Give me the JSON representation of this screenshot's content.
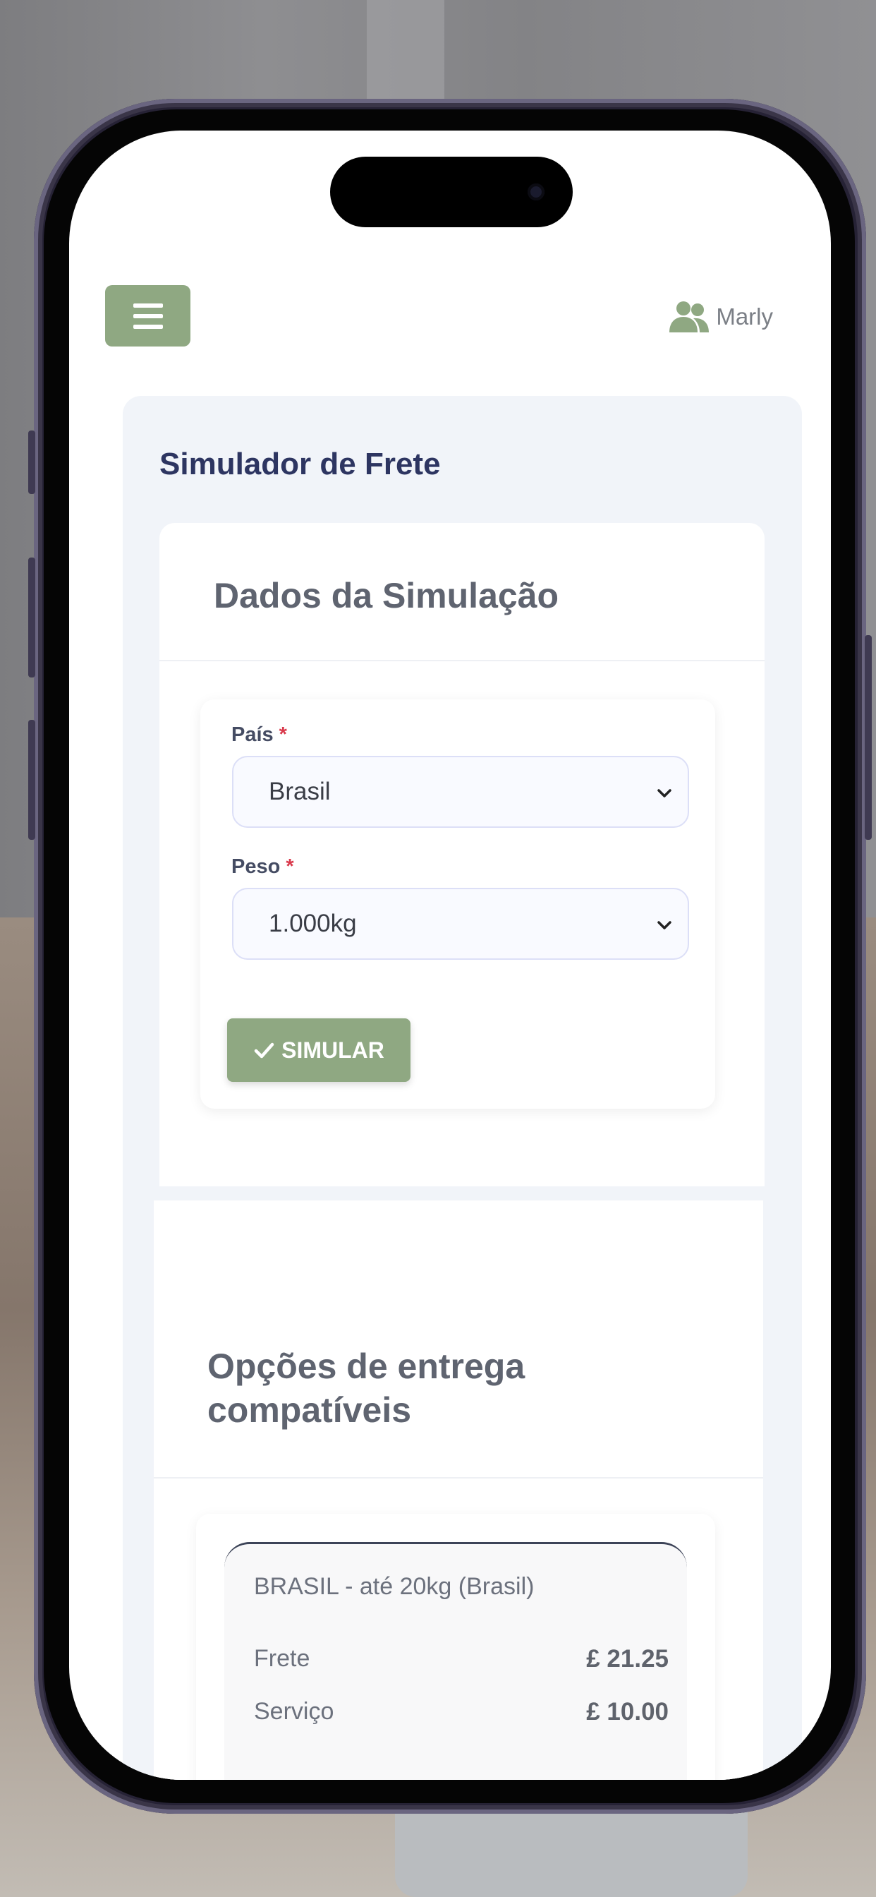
{
  "header": {
    "user_name": "Marly",
    "menu_icon": "hamburger-menu-icon",
    "user_icon": "users-icon"
  },
  "page": {
    "title": "Simulador de Frete"
  },
  "simulation": {
    "title": "Dados da Simulação",
    "country": {
      "label": "País",
      "required_mark": "*",
      "value": "Brasil"
    },
    "weight": {
      "label": "Peso",
      "required_mark": "*",
      "value": "1.000kg"
    },
    "submit_label": "SIMULAR",
    "submit_icon": "check-icon"
  },
  "delivery": {
    "title": "Opções de entrega compatíveis",
    "options": [
      {
        "name": "BRASIL - até 20kg (Brasil)",
        "fees": [
          {
            "label": "Frete",
            "value": "£ 21.25"
          },
          {
            "label": "Serviço",
            "value": "£ 10.00"
          }
        ]
      }
    ]
  },
  "colors": {
    "accent": "#8fa882",
    "title": "#2d3561",
    "required": "#d9394b",
    "card_background": "#f1f4f9"
  }
}
